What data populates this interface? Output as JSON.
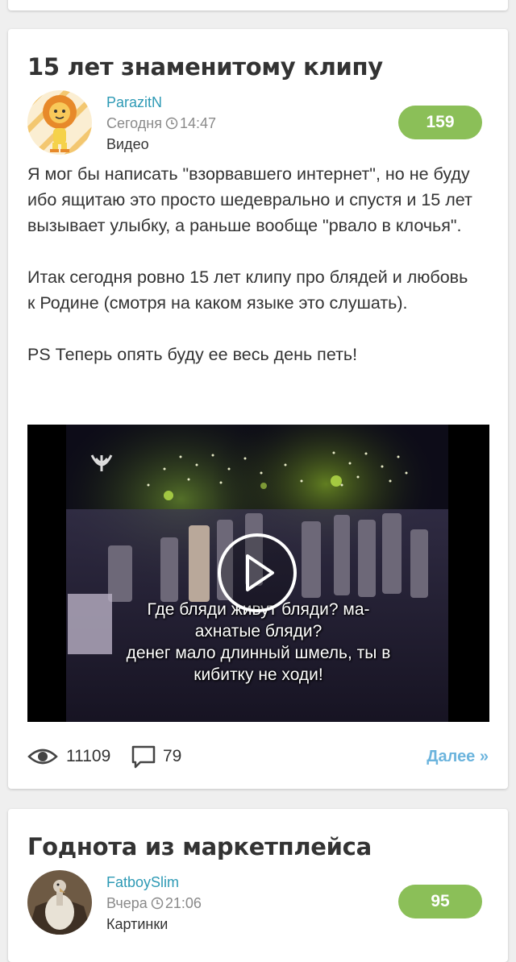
{
  "post": {
    "title": "15 лет знаменитому клипу",
    "author": "ParazitN",
    "date": "Сегодня",
    "time": "14:47",
    "category": "Видео",
    "rating": "159",
    "paragraphs": [
      "Я мог бы написать \"взорвавшего интернет\", но не буду ибо ящитаю это просто шедеврально и спустя и 15 лет вызывает улыбку, а раньше вообще \"рвало в клочья\".",
      "Итак сегодня ровно 15 лет клипу про блядей и любовь к Родине (смотря на каком языке это слушать).",
      "PS Теперь опять буду ее весь день петь!"
    ],
    "video": {
      "subtitle_lines": [
        "Где бляди живут бляди? ма-",
        "ахнатые бляди?",
        "денег мало длинный шмель, ты в",
        "кибитку не ходи!"
      ]
    },
    "views": "11109",
    "comments": "79",
    "more_label": "Далее »"
  },
  "next_post": {
    "title": "Годнота из маркетплейса",
    "author": "FatboySlim",
    "date": "Вчера",
    "time": "21:06",
    "category": "Картинки",
    "rating": "95"
  },
  "colors": {
    "accent_link": "#2e9ab5",
    "rating_bg": "#8bbf58",
    "more_link": "#6cb4dd"
  }
}
